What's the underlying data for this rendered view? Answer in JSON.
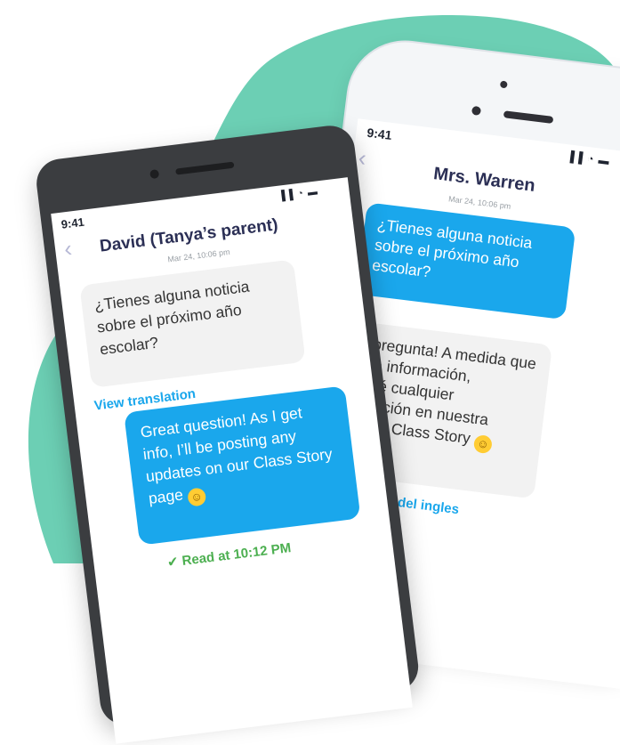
{
  "back_phone": {
    "time": "9:41",
    "status_icons": "▐▐ ◔ ▬",
    "back_glyph": "‹",
    "contact": "Mrs. Warren",
    "date": "Mar 24, 10:06 pm",
    "message_in": "¿Tienes alguna noticia sobre el próximo año escolar?",
    "reply": "¡Gran pregunta! A medida que obtenga información, publicaré cualquier actualización en nuestra página de Class Story",
    "emoji": "☺",
    "translated_label": "Traducida del ingles"
  },
  "front_phone": {
    "time": "9:41",
    "status_icons": "▐▐ ◔ ▬",
    "back_glyph": "‹",
    "contact": "David (Tanya’s parent)",
    "date": "Mar 24, 10:06 pm",
    "message_in": "¿Tienes alguna noticia sobre el próximo año escolar?",
    "view_translation": "View translation",
    "reply": "Great question! As I get info, I’ll be posting any updates on our Class Story page",
    "emoji": "☺",
    "read_receipt": "✔ Read at 10:12 PM"
  },
  "colors": {
    "blob": "#6ccfb4",
    "accent": "#1aa7ec",
    "read": "#4caf50",
    "title": "#2b2f55"
  }
}
